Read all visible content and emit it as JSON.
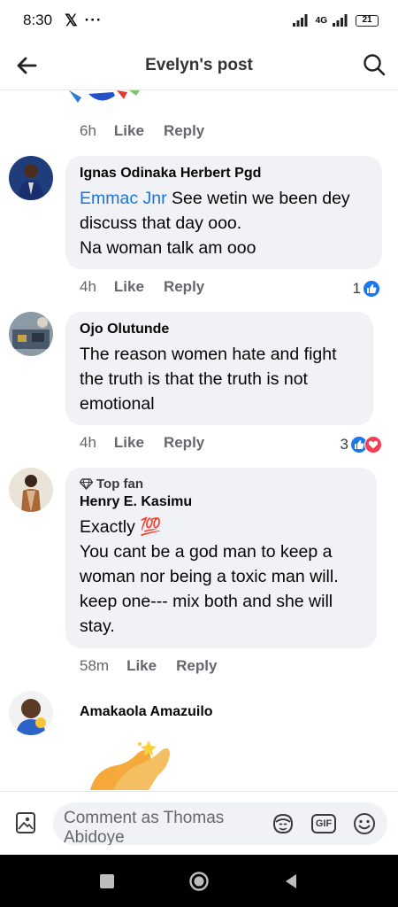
{
  "status_bar": {
    "time": "8:30",
    "x_logo": "𝕏",
    "dots": "···",
    "network": "4G",
    "battery": "21"
  },
  "header": {
    "title": "Evelyn's post",
    "back_icon": "arrow-left-icon",
    "search_icon": "search-icon"
  },
  "comments": [
    {
      "time": "6h",
      "like": "Like",
      "reply": "Reply"
    },
    {
      "author": "Ignas Odinaka Herbert Pgd",
      "mention": "Emmac Jnr",
      "text_after_mention": " See wetin we been dey discuss that day ooo.",
      "text_line2": "Na woman talk am ooo",
      "time": "4h",
      "like": "Like",
      "reply": "Reply",
      "reaction_count": "1"
    },
    {
      "author": "Ojo Olutunde",
      "text": "The reason women hate and fight the truth is that the truth is not emotional",
      "time": "4h",
      "like": "Like",
      "reply": "Reply",
      "reaction_count": "3"
    },
    {
      "badge": "Top fan",
      "author": "Henry E. Kasimu",
      "text_line1": "Exactly 💯",
      "text_line2": "You cant be a god man to keep a woman nor being a toxic man will. keep one--- mix both and she will stay.",
      "time": "58m",
      "like": "Like",
      "reply": "Reply"
    },
    {
      "author": "Amakaola Amazuilo",
      "sticker": "clapping-hands-sticker"
    }
  ],
  "composer": {
    "placeholder": "Comment as Thomas Abidoye",
    "photo_icon": "photo-icon",
    "avatar_icon": "avatar-sticker-icon",
    "gif_label": "GIF",
    "emoji_icon": "emoji-icon"
  },
  "colors": {
    "link_blue": "#1b74e4",
    "bubble_bg": "#f0f2f5",
    "like_blue": "#1877f2",
    "love_red": "#f33e58"
  }
}
